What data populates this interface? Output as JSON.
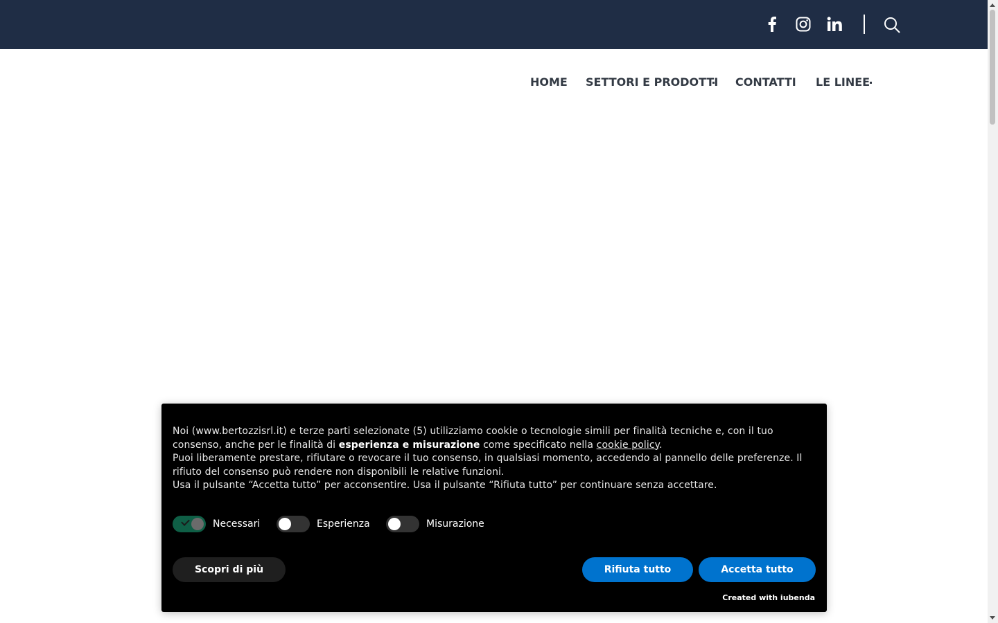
{
  "topbar": {
    "background": "#1f2d45",
    "icons": [
      "facebook-icon",
      "instagram-icon",
      "linkedin-icon",
      "search-icon"
    ]
  },
  "nav": {
    "items": [
      {
        "label": "HOME",
        "has_submenu": false
      },
      {
        "label": "SETTORI E PRODOTTI",
        "has_submenu": true
      },
      {
        "label": "CONTATTI",
        "has_submenu": false
      },
      {
        "label": "LE LINEE",
        "has_submenu": true
      }
    ]
  },
  "cookie_banner": {
    "text_intro": "Noi (www.bertozzisrl.it) e terze parti selezionate (5) utilizziamo cookie o tecnologie simili per finalità tecniche e, con il tuo consenso, anche per le finalità di ",
    "text_bold": "esperienza e misurazione",
    "text_mid": " come specificato nella ",
    "policy_link": "cookie policy",
    "text_period": ".",
    "text_line2": "Puoi liberamente prestare, rifiutare o revocare il tuo consenso, in qualsiasi momento, accedendo al pannello delle preferenze. Il rifiuto del consenso può rendere non disponibili le relative funzioni.",
    "text_line3": "Usa il pulsante “Accetta tutto” per acconsentire. Usa il pulsante “Rifiuta tutto” per continuare senza accettare.",
    "toggles": [
      {
        "label": "Necessari",
        "checked": true
      },
      {
        "label": "Esperienza",
        "checked": false
      },
      {
        "label": "Misurazione",
        "checked": false
      }
    ],
    "learn_more_label": "Scopri di più",
    "reject_label": "Rifiuta tutto",
    "accept_label": "Accetta tutto",
    "powered_by": "Created with iubenda",
    "accent_color": "#0073ce"
  }
}
